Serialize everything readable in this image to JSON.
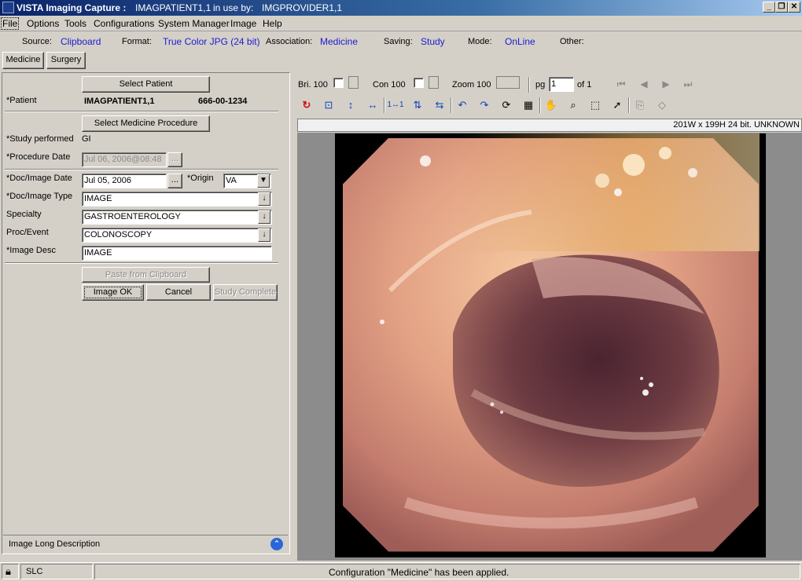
{
  "window": {
    "app_title": "VISTA Imaging Capture :",
    "patient": "IMAGPATIENT1,1",
    "in_use_label": "in use by:",
    "provider": "IMGPROVIDER1,1"
  },
  "menu": [
    "File",
    "Options",
    "Tools",
    "Configurations",
    "System Manager",
    "Image",
    "Help"
  ],
  "info": {
    "source_label": "Source:",
    "source_value": "Clipboard",
    "format_label": "Format:",
    "format_value": "True Color JPG (24 bit)",
    "association_label": "Association:",
    "association_value": "Medicine",
    "saving_label": "Saving:",
    "saving_value": "Study",
    "mode_label": "Mode:",
    "mode_value": "OnLine",
    "other_label": "Other:"
  },
  "config_tabs": [
    "Medicine",
    "Surgery"
  ],
  "form": {
    "select_patient": "Select Patient",
    "patient_label": "*Patient",
    "patient_name": "IMAGPATIENT1,1",
    "patient_ssn": "666-00-1234",
    "select_procedure": "Select Medicine Procedure",
    "study_performed_label": "*Study performed",
    "study_performed_value": "GI",
    "procedure_date_label": "*Procedure Date",
    "procedure_date_value": "Jul 06, 2006@08:48",
    "doc_date_label": "*Doc/Image Date",
    "doc_date_value": "Jul 05, 2006",
    "ellipsis": "...",
    "origin_label": "*Origin",
    "origin_value": "VA",
    "doc_type_label": "*Doc/Image Type",
    "doc_type_value": "IMAGE",
    "specialty_label": "Specialty",
    "specialty_value": "GASTROENTEROLOGY",
    "proc_event_label": "Proc/Event",
    "proc_event_value": "COLONOSCOPY",
    "image_desc_label": "*Image Desc",
    "image_desc_value": "IMAGE",
    "paste_clipboard": "Paste from Clipboard",
    "image_ok": "Image OK",
    "cancel": "Cancel",
    "study_complete": "Study Complete",
    "long_desc_label": "Image Long Description"
  },
  "viewer": {
    "bri_label": "Bri. 100",
    "con_label": "Con  100",
    "zoom_label": "Zoom 100",
    "pg_label": "pg",
    "pg_value": "1",
    "of_label": "of 1",
    "image_info": "201W x 199H   24 bit.  UNKNOWN",
    "toolbar_icons": [
      "refresh-icon",
      "fit-window-icon",
      "fit-height-icon",
      "fit-width-icon",
      "actual-size-icon",
      "flip-vertical-icon",
      "flip-horizontal-icon",
      "rotate-left-icon",
      "rotate-right-icon",
      "rotate-180-icon",
      "invert-icon",
      "pan-icon",
      "magnify-icon",
      "select-region-icon",
      "pointer-icon",
      "copy-icon",
      "clear-icon"
    ],
    "actual_size_glyph": "1↔1"
  },
  "status": {
    "user": "SLC",
    "message": "Configuration \"Medicine\" has been applied."
  }
}
